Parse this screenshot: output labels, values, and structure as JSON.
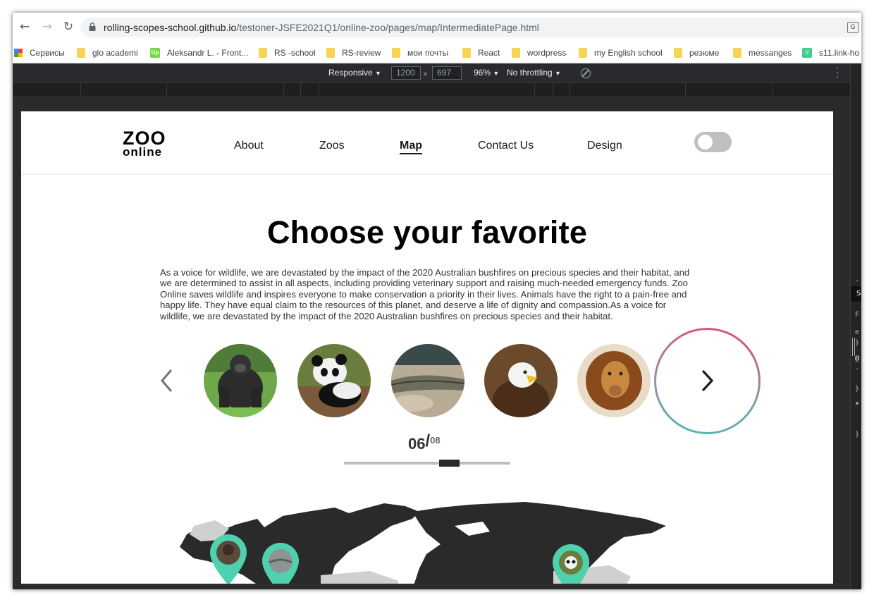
{
  "browser": {
    "url_host": "rolling-scopes-school.github.io",
    "url_path": "/testoner-JSFE2021Q1/online-zoo/pages/map/IntermediatePage.html",
    "bookmarks": [
      {
        "label": "Сервисы",
        "icon": "apps-grid-icon"
      },
      {
        "label": "glo academi",
        "icon": "folder-icon"
      },
      {
        "label": "Aleksandr L. - Front...",
        "icon": "upwork-icon"
      },
      {
        "label": "RS -school",
        "icon": "folder-icon"
      },
      {
        "label": "RS-review",
        "icon": "folder-icon"
      },
      {
        "label": "мои почты",
        "icon": "folder-icon"
      },
      {
        "label": "React",
        "icon": "folder-icon"
      },
      {
        "label": "wordpress",
        "icon": "folder-icon"
      },
      {
        "label": "my English school",
        "icon": "folder-icon"
      },
      {
        "label": "резюме",
        "icon": "folder-icon"
      },
      {
        "label": "messanges",
        "icon": "folder-icon"
      },
      {
        "label": "s11.link-ho",
        "icon": "link-icon"
      }
    ]
  },
  "devtools": {
    "device": "Responsive",
    "width": "1200",
    "times": "×",
    "height": "697",
    "zoom": "96%",
    "throttling": "No throttling"
  },
  "site": {
    "logo_line1": "ZOO",
    "logo_line2": "online",
    "nav": [
      "About",
      "Zoos",
      "Map",
      "Contact Us",
      "Design"
    ],
    "active_nav": "Map",
    "theme_toggle_on": false,
    "heading": "Choose your favorite",
    "intro": "As a voice for wildlife, we are devastated by the impact of the 2020 Australian bushfires on precious species and their habitat, and we are determined to assist in all aspects, including providing veterinary support and raising much-needed emergency funds. Zoo Online saves wildlife and inspires everyone to make conservation a priority in their lives. Animals have the right to a pain-free and happy life. They have equal claim to the resources of this planet, and deserve a life of dignity and compassion.As a voice for wildlife, we are devastated by the impact of the 2020 Australian bushfires on precious species and their habitat.",
    "animals": [
      "gorilla",
      "panda",
      "alligator",
      "eagle",
      "lion"
    ],
    "counter_current": "06",
    "counter_slash": "/",
    "counter_total": "08",
    "slider_position": 0.65,
    "map_pins": [
      "gorilla",
      "alligator",
      "panda"
    ],
    "colors": {
      "accent_pin": "#4fd1b0",
      "ring_teal": "#4fb8b4",
      "ring_pink": "#d4587a",
      "map_dark": "#2a2a2a"
    }
  }
}
